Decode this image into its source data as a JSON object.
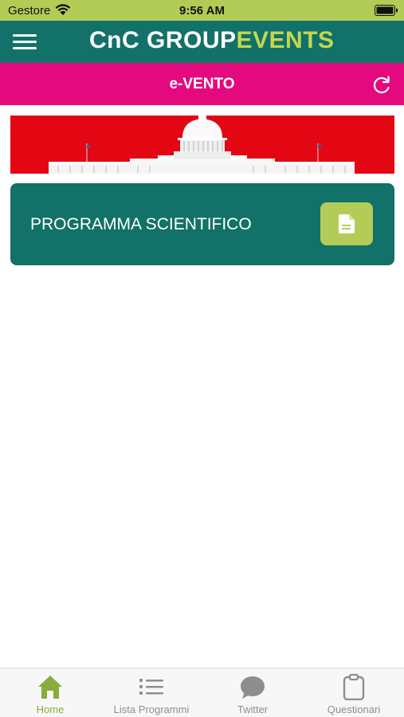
{
  "status_bar": {
    "carrier": "Gestore",
    "time": "9:56 AM"
  },
  "header": {
    "logo_part1": "CnC GROUP",
    "logo_part2": "EVENTS"
  },
  "title_bar": {
    "title": "e-VENTO"
  },
  "card": {
    "label": "PROGRAMMA SCIENTIFICO",
    "icon": "document-icon"
  },
  "tabs": [
    {
      "label": "Home",
      "icon": "home-icon",
      "active": true
    },
    {
      "label": "Lista Programmi",
      "icon": "list-icon"
    },
    {
      "label": "Twitter",
      "icon": "chat-bubble-icon"
    },
    {
      "label": "Questionari",
      "icon": "clipboard-icon"
    }
  ],
  "colors": {
    "status_bar": "#b3cc57",
    "header": "#127168",
    "title_bar": "#e5097f",
    "banner": "#e30613",
    "accent_green": "#b3cc57",
    "tab_active": "#8aac3c",
    "tab_inactive": "#8e8e8e"
  }
}
